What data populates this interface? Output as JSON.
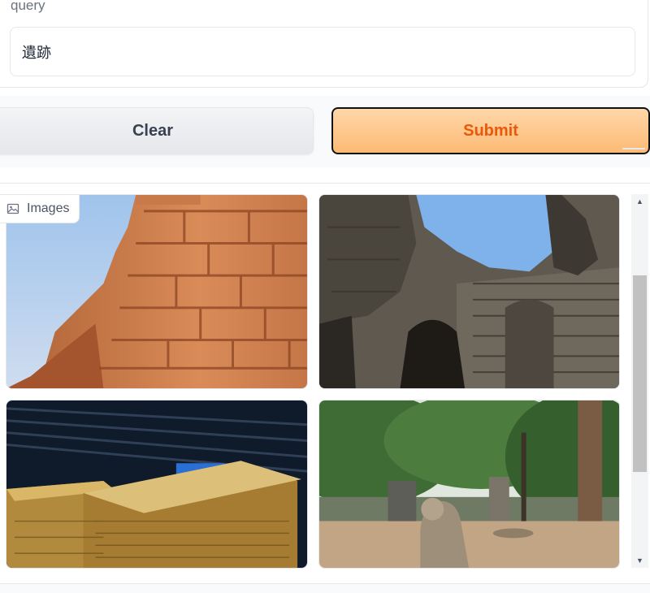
{
  "query": {
    "label": "query",
    "value": "遺跡"
  },
  "buttons": {
    "clear_label": "Clear",
    "submit_label": "Submit"
  },
  "gallery": {
    "label": "Images",
    "icon": "image-icon",
    "items": [
      {
        "subject": "sandstone-brick-ruin"
      },
      {
        "subject": "angkor-temple-gate"
      },
      {
        "subject": "golden-sarcophagi-museum"
      },
      {
        "subject": "komainu-shrine-grove"
      }
    ]
  },
  "colors": {
    "submit_bg": "#fdba74",
    "submit_text": "#ea580c",
    "clear_bg": "#e5e7eb"
  }
}
